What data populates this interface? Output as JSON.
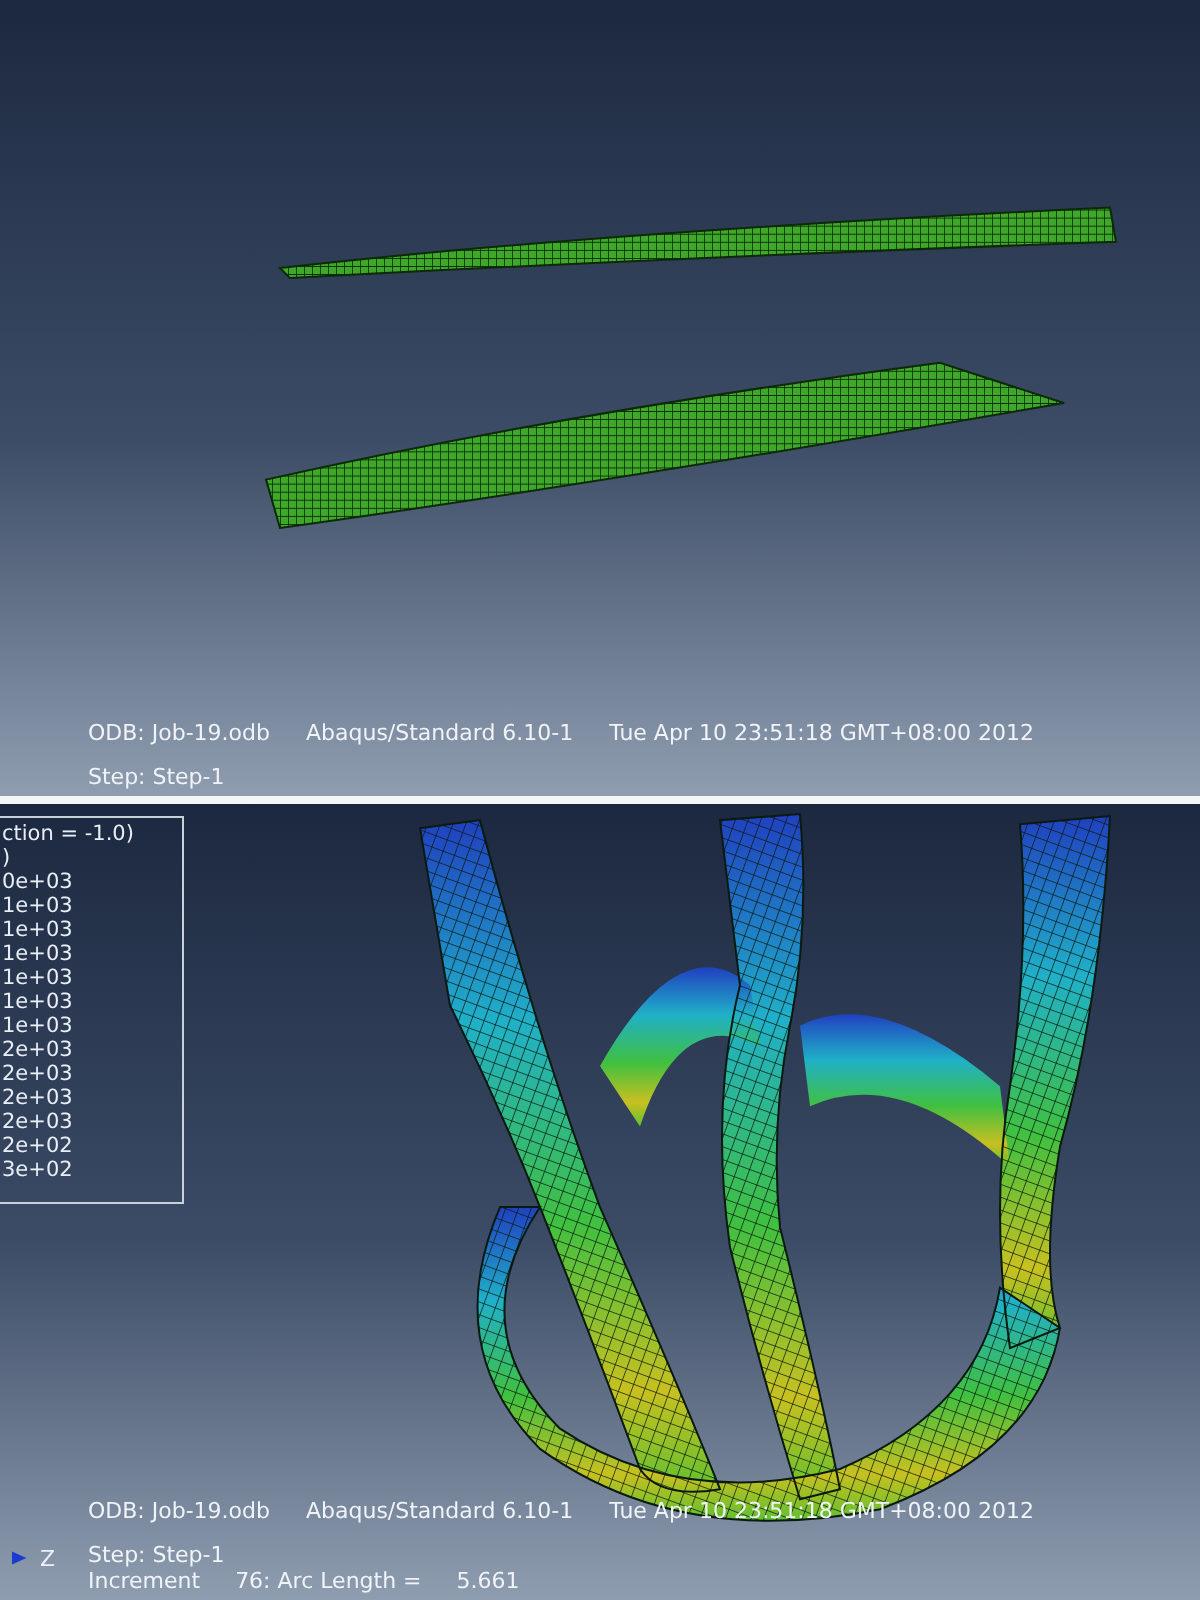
{
  "viewports": [
    {
      "kind": "undeformed",
      "status": {
        "odb": "ODB: Job-19.odb",
        "product": "Abaqus/Standard 6.10-1",
        "date": "Tue Apr 10 23:51:18 GMT+08:00 2012",
        "step": "Step: Step-1"
      }
    },
    {
      "kind": "contour",
      "legend": [
        "ction = -1.0)",
        ")",
        "0e+03",
        "1e+03",
        "1e+03",
        "1e+03",
        "1e+03",
        "1e+03",
        "1e+03",
        "2e+03",
        "2e+03",
        "2e+03",
        "2e+03",
        "2e+02",
        "3e+02"
      ],
      "axis_label": "Z",
      "status": {
        "odb": "ODB: Job-19.odb",
        "product": "Abaqus/Standard 6.10-1",
        "date": "Tue Apr 10 23:51:18 GMT+08:00 2012",
        "step": "Step: Step-1",
        "increment": "Increment     76: Arc Length =     5.661"
      }
    }
  ]
}
